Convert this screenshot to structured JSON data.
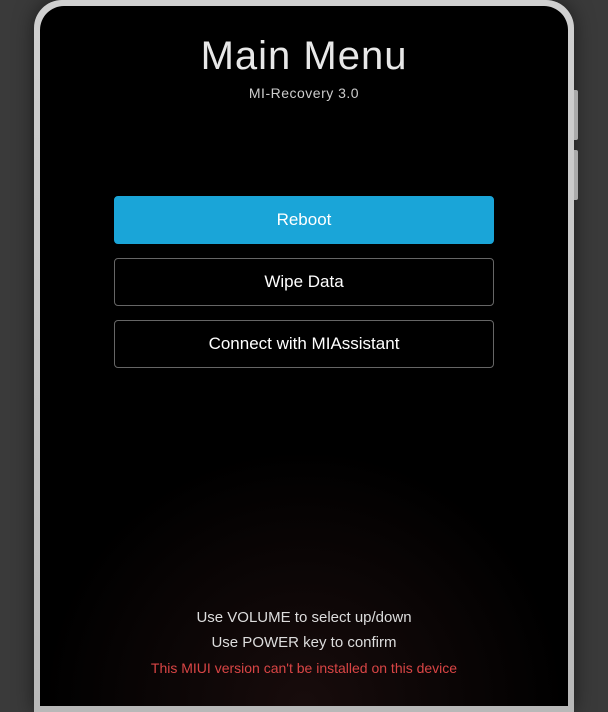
{
  "header": {
    "title": "Main Menu",
    "subtitle": "MI-Recovery 3.0"
  },
  "menu": {
    "items": [
      {
        "label": "Reboot",
        "selected": true
      },
      {
        "label": "Wipe Data",
        "selected": false
      },
      {
        "label": "Connect with MIAssistant",
        "selected": false
      }
    ]
  },
  "footer": {
    "hint1": "Use VOLUME to select up/down",
    "hint2": "Use POWER key to confirm",
    "error": "This MIUI version can't be installed on this device"
  }
}
